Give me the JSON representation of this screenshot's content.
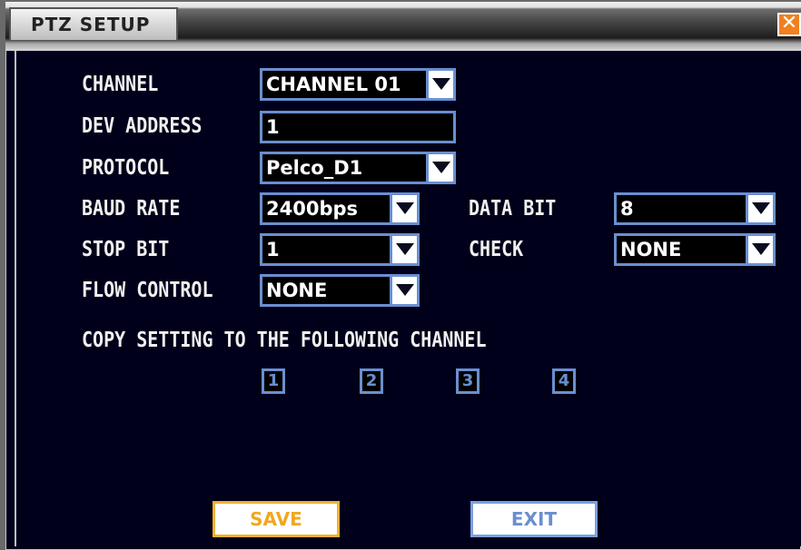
{
  "window": {
    "title": "PTZ SETUP",
    "close_icon": "close-icon"
  },
  "labels": {
    "channel": "CHANNEL",
    "dev_address": "DEV ADDRESS",
    "protocol": "PROTOCOL",
    "baud_rate": "BAUD RATE",
    "data_bit": "DATA BIT",
    "stop_bit": "STOP BIT",
    "check": "CHECK",
    "flow_control": "FLOW CONTROL",
    "copy_setting": "COPY SETTING TO THE FOLLOWING CHANNEL"
  },
  "values": {
    "channel": "CHANNEL 01",
    "dev_address": "1",
    "protocol": "Pelco_D1",
    "baud_rate": "2400bps",
    "data_bit": "8",
    "stop_bit": "1",
    "check": "NONE",
    "flow_control": "NONE"
  },
  "copy_channels": [
    "1",
    "2",
    "3",
    "4"
  ],
  "buttons": {
    "save": "SAVE",
    "exit": "EXIT"
  },
  "colors": {
    "accent": "#6a8fd0",
    "save": "#f0a820",
    "background": "#00001a"
  }
}
